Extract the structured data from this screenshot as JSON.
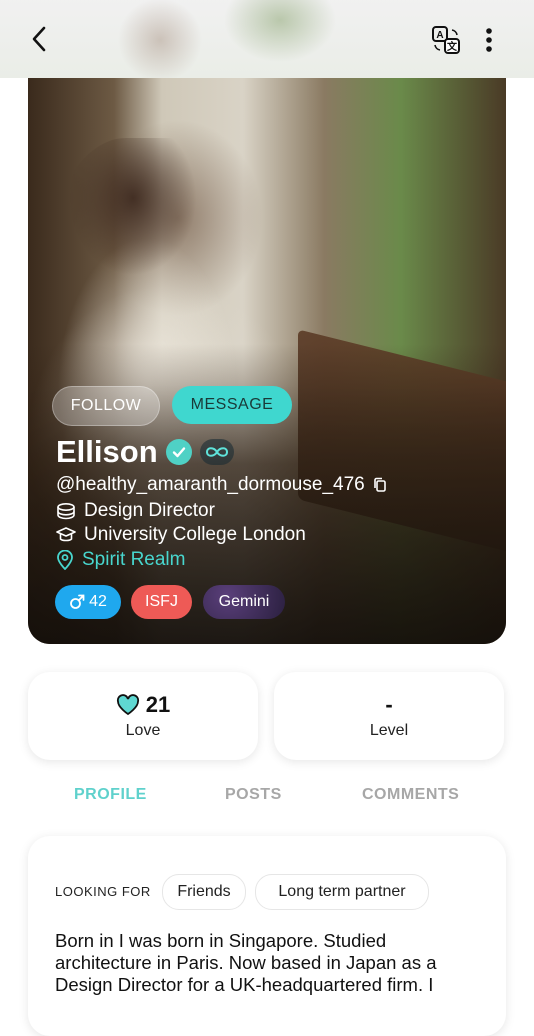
{
  "header": {
    "back_icon": "chevron-left-icon",
    "translate_icon": "translate-icon",
    "more_icon": "more-vertical-icon"
  },
  "hero": {
    "follow_label": "FOLLOW",
    "message_label": "MESSAGE",
    "name": "Ellison",
    "handle": "@healthy_amaranth_dormouse_476",
    "job": "Design Director",
    "school": "University College London",
    "location": "Spirit Realm",
    "chips": {
      "age": "42",
      "mbti": "ISFJ",
      "zodiac": "Gemini"
    },
    "colors": {
      "accent": "#3fd7cf",
      "age_chip": "#1fa8ee",
      "mbti_chip": "#ee5a56"
    }
  },
  "stats": {
    "love_value": "21",
    "love_label": "Love",
    "level_value": "-",
    "level_label": "Level"
  },
  "tabs": {
    "profile": "PROFILE",
    "posts": "POSTS",
    "comments": "COMMENTS"
  },
  "profile": {
    "looking_for_label": "LOOKING FOR",
    "looking_for": [
      "Friends",
      "Long term partner"
    ],
    "bio": "Born in I was born in Singapore. Studied architecture in Paris. Now based in Japan as a Design Director for a UK-headquartered firm. I"
  }
}
